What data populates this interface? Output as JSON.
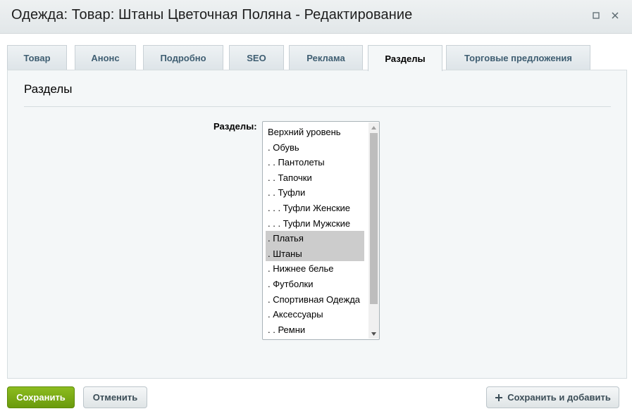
{
  "window": {
    "title": "Одежда: Товар: Штаны Цветочная Поляна - Редактирование",
    "icons": {
      "maximize": "maximize-icon",
      "close": "close-icon"
    }
  },
  "tabs": [
    {
      "label": "Товар",
      "active": false
    },
    {
      "label": "Анонс",
      "active": false
    },
    {
      "label": "Подробно",
      "active": false
    },
    {
      "label": "SEO",
      "active": false
    },
    {
      "label": "Реклама",
      "active": false
    },
    {
      "label": "Разделы",
      "active": true
    },
    {
      "label": "Торговые предложения",
      "active": false
    }
  ],
  "section": {
    "title": "Разделы",
    "field_label": "Разделы:",
    "list_items": [
      {
        "label": "Верхний уровень",
        "selected": false
      },
      {
        "label": ". Обувь",
        "selected": false
      },
      {
        "label": ". . Пантолеты",
        "selected": false
      },
      {
        "label": ". . Тапочки",
        "selected": false
      },
      {
        "label": ". . Туфли",
        "selected": false
      },
      {
        "label": ". . . Туфли Женские",
        "selected": false
      },
      {
        "label": ". . . Туфли Мужские",
        "selected": false
      },
      {
        "label": ". Платья",
        "selected": true
      },
      {
        "label": ". Штаны",
        "selected": true
      },
      {
        "label": ". Нижнее белье",
        "selected": false
      },
      {
        "label": ". Футболки",
        "selected": false
      },
      {
        "label": ". Спортивная Одежда",
        "selected": false
      },
      {
        "label": ". Аксессуары",
        "selected": false
      },
      {
        "label": ". . Ремни",
        "selected": false
      }
    ]
  },
  "footer": {
    "save_label": "Сохранить",
    "cancel_label": "Отменить",
    "save_add_label": "Сохранить и добавить"
  },
  "colors": {
    "accent_green": "#7aab15",
    "tab_text": "#3f5e72",
    "selection": "#cccccc"
  }
}
